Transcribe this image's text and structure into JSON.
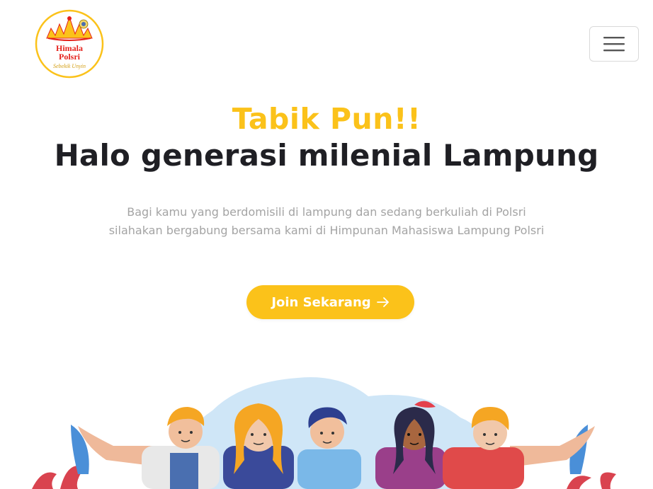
{
  "navbar": {
    "logo": {
      "text_line1": "Himala",
      "text_line2": "Polsri",
      "script_text": "Sebekik Unyin",
      "brand_color": "#e4211b",
      "accent_color": "#fbc21a"
    },
    "menu_button_icon": "hamburger-icon"
  },
  "hero": {
    "greeting": "Tabik Pun!!",
    "headline": "Halo generasi milenial Lampung",
    "description_line1": "Bagi kamu yang berdomisili di lampung dan sedang berkuliah di Polsri",
    "description_line2": "silahakan bergabung bersama kami di Himpunan Mahasiswa Lampung Polsri",
    "cta_label": "Join Sekarang",
    "cta_icon": "arrow-right-icon"
  },
  "colors": {
    "accent": "#fbc21a",
    "heading": "#1f1f24",
    "body_text": "#a4a4a4",
    "illustration_blob": "#cfe6f7",
    "leaf_red": "#d9434f",
    "leaf_blue": "#4a8fd8"
  },
  "illustration": {
    "description_icon": "group-of-youth-illustration"
  }
}
